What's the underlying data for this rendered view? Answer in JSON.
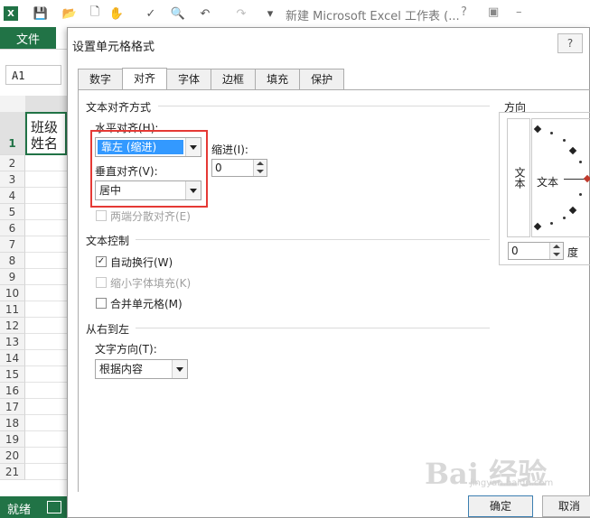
{
  "excel": {
    "file_icon": "X",
    "title": "新建 Microsoft Excel 工作表 (...",
    "help": "?",
    "file_tab": "文件",
    "name_box": "A1",
    "cell_a1": "班级\n姓名",
    "rows": [
      "1",
      "2",
      "3",
      "4",
      "5",
      "6",
      "7",
      "8",
      "9",
      "10",
      "11",
      "12",
      "13",
      "14",
      "15",
      "16",
      "17",
      "18",
      "19",
      "20",
      "21"
    ],
    "status": "就绪",
    "accent": "#217346",
    "restore_icon": "restore-icon",
    "maximize_icon": "maximize-icon",
    "quick_access_icons": [
      "save-icon",
      "open-icon",
      "new-doc-icon",
      "touch-mode-icon",
      "spelling-icon",
      "print-preview-icon",
      "undo-icon",
      "redo-icon",
      "customize-icon"
    ]
  },
  "dialog": {
    "title": "设置单元格格式",
    "help": "?",
    "tabs": [
      "数字",
      "对齐",
      "字体",
      "边框",
      "填充",
      "保护"
    ],
    "active_tab": "对齐",
    "text_alignment": {
      "heading": "文本对齐方式",
      "horizontal_label": "水平对齐(H):",
      "horizontal_value": "靠左 (缩进)",
      "vertical_label": "垂直对齐(V):",
      "vertical_value": "居中",
      "indent_label": "缩进(I):",
      "indent_value": "0",
      "justify_distributed": "两端分散对齐(E)"
    },
    "text_control": {
      "heading": "文本控制",
      "wrap_text": "自动换行(W)",
      "wrap_text_checked": true,
      "shrink_to_fit": "缩小字体填充(K)",
      "merge_cells": "合并单元格(M)"
    },
    "rtl": {
      "heading": "从右到左",
      "direction_label": "文字方向(T):",
      "direction_value": "根据内容"
    },
    "orientation": {
      "heading": "方向",
      "vertical_text": "文本",
      "dial_text": "文本",
      "degrees_value": "0",
      "degrees_label": "度"
    },
    "ok": "确定",
    "cancel": "取消",
    "highlight_color": "#e53935"
  },
  "watermark": {
    "text": "Bai 经验",
    "sub": "jingyan.baidu.com"
  }
}
